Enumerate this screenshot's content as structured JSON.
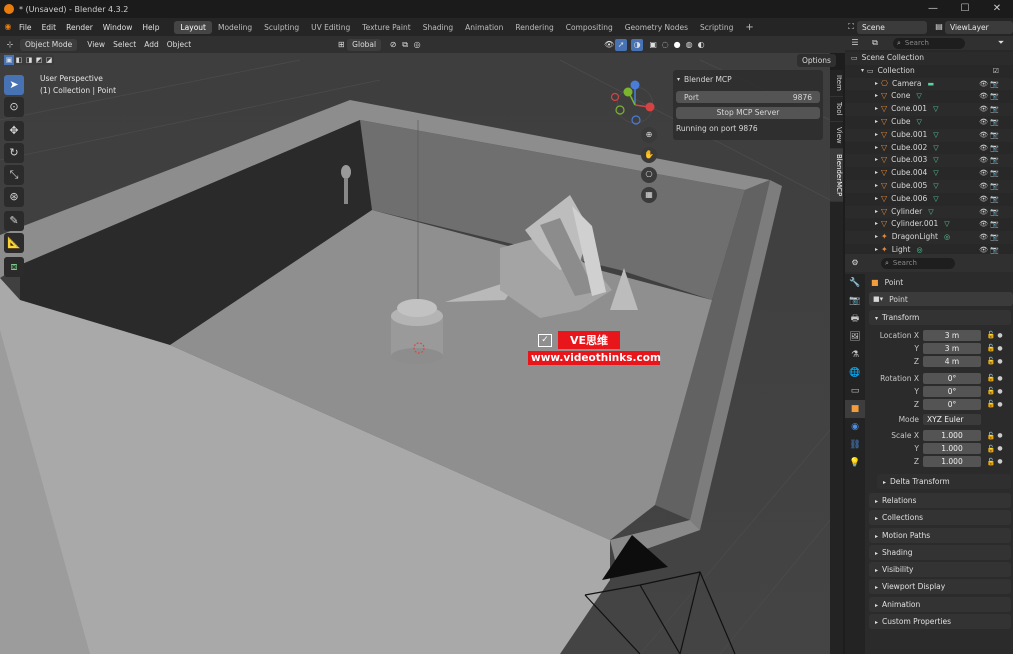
{
  "titlebar": {
    "title": "* (Unsaved) - Blender 4.3.2",
    "minimize": "—",
    "maximize": "☐",
    "close": "✕"
  },
  "menu": {
    "items": [
      "File",
      "Edit",
      "Render",
      "Window",
      "Help"
    ]
  },
  "workspaces": [
    "Layout",
    "Modeling",
    "Sculpting",
    "UV Editing",
    "Texture Paint",
    "Shading",
    "Animation",
    "Rendering",
    "Compositing",
    "Geometry Nodes",
    "Scripting"
  ],
  "workspace_add": "+",
  "scene": {
    "name": "Scene",
    "viewlayer": "ViewLayer"
  },
  "viewport_header": {
    "mode": "Object Mode",
    "menus": [
      "View",
      "Select",
      "Add",
      "Object"
    ],
    "orientation": "Global",
    "options": "Options"
  },
  "overlay_text": {
    "perspective": "User Perspective",
    "collection_line": "(1) Collection | Point"
  },
  "mcp_panel": {
    "title": "Blender MCP",
    "port_label": "Port",
    "port_value": "9876",
    "button": "Stop MCP Server",
    "status": "Running on port 9876"
  },
  "n_tabs": [
    "Item",
    "Tool",
    "View",
    "BlenderMCP"
  ],
  "watermark": {
    "brand": "VE思维",
    "url": "www.videothinks.com"
  },
  "outliner": {
    "search_placeholder": "Search",
    "root": "Scene Collection",
    "collection": "Collection",
    "items": [
      "Camera",
      "Cone",
      "Cone.001",
      "Cube",
      "Cube.001",
      "Cube.002",
      "Cube.003",
      "Cube.004",
      "Cube.005",
      "Cube.006",
      "Cylinder",
      "Cylinder.001",
      "DragonLight",
      "Light"
    ]
  },
  "properties": {
    "search_placeholder": "Search",
    "object_name": "Point",
    "data_name": "Point",
    "transform": {
      "title": "Transform",
      "location_label": "Location X",
      "location": [
        "3 m",
        "3 m",
        "4 m"
      ],
      "rotation_label": "Rotation X",
      "rotation": [
        "0°",
        "0°",
        "0°"
      ],
      "mode_label": "Mode",
      "mode": "XYZ Euler",
      "scale_label": "Scale X",
      "scale": [
        "1.000",
        "1.000",
        "1.000"
      ],
      "axis_y": "Y",
      "axis_z": "Z",
      "delta": "Delta Transform"
    },
    "panels": [
      "Relations",
      "Collections",
      "Motion Paths",
      "Shading",
      "Visibility",
      "Viewport Display",
      "Animation",
      "Custom Properties"
    ]
  },
  "colors": {
    "accent": "#4772b3",
    "object_orange": "#e08a3a",
    "mesh_green": "#5bd0a0",
    "watermark_red": "#e8151b"
  }
}
